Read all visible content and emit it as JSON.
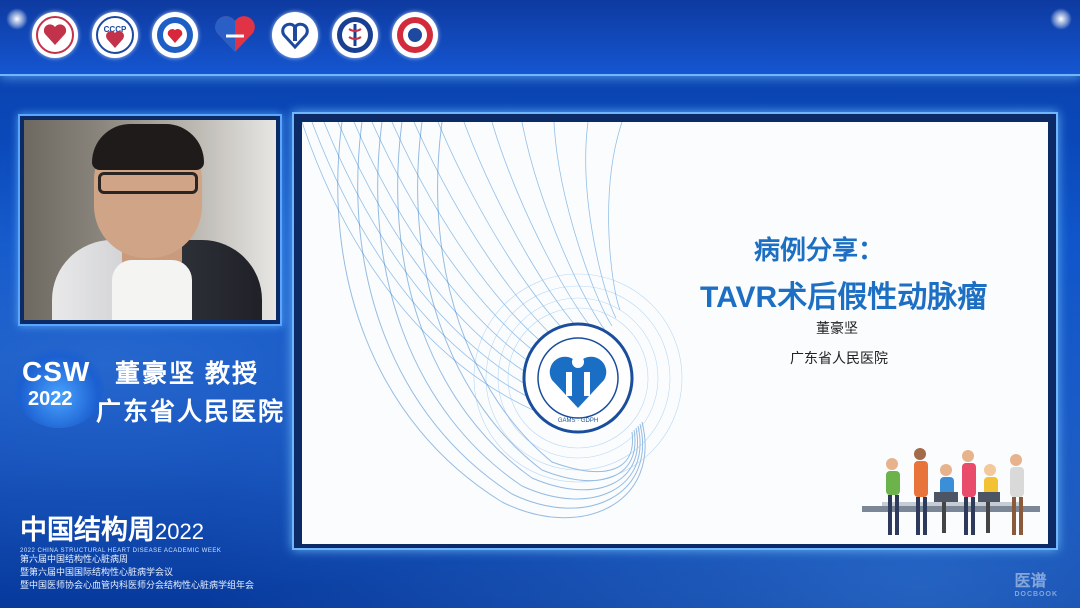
{
  "header": {
    "logos": [
      {
        "icon": "association-logo-icon"
      },
      {
        "icon": "cccp-logo-icon",
        "text": "CCCP"
      },
      {
        "icon": "heart-emblem-logo-icon"
      },
      {
        "icon": "heart-hands-logo-icon"
      },
      {
        "icon": "heart-center-logo-icon"
      },
      {
        "icon": "medical-society-logo-icon"
      },
      {
        "icon": "foundation-logo-icon"
      }
    ]
  },
  "speaker": {
    "name": "董豪坚  教授",
    "organization": "广东省人民医院",
    "badge_line1": "CSW",
    "badge_line2": "2022"
  },
  "branding": {
    "title": "中国结构周",
    "year": "2022",
    "subtitle_en": "2022 CHINA STRUCTURAL HEART DISEASE ACADEMIC WEEK",
    "lines": [
      "第六届中国结构性心脏病周",
      "暨第六届中国国际结构性心脏病学会议",
      "暨中国医师协会心血管内科医师分会结构性心脏病学组年会"
    ]
  },
  "slide": {
    "title_line1": "病例分享：",
    "title_line2": "TAVR术后假性动脉瘤",
    "author": "董豪坚",
    "organization": "广东省人民医院",
    "emblem_text": "GAMS · GDPH"
  },
  "watermark": {
    "text": "医谱",
    "sub": "DOCBOOK"
  },
  "colors": {
    "background": "#0a4fc6",
    "accent": "#1c6fc2",
    "frame": "#6fb6ff"
  }
}
